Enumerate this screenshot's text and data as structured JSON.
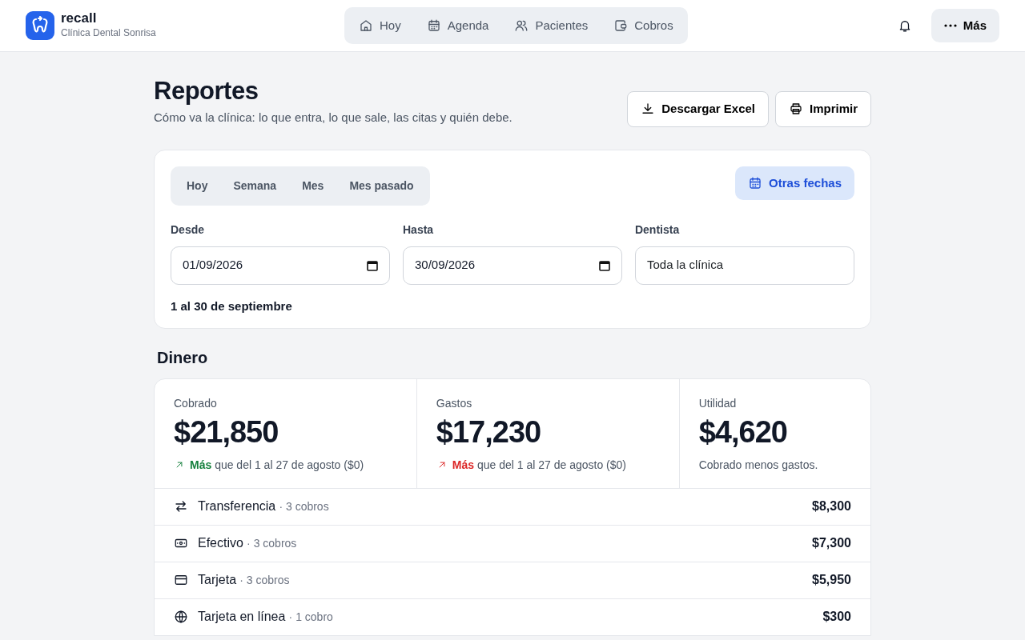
{
  "brand": {
    "name": "recall",
    "clinic": "Clínica Dental Sonrisa"
  },
  "nav": [
    {
      "label": "Hoy",
      "kind": "home"
    },
    {
      "label": "Agenda",
      "kind": "calendar"
    },
    {
      "label": "Pacientes",
      "kind": "people"
    },
    {
      "label": "Cobros",
      "kind": "wallet"
    }
  ],
  "more_button": "Más",
  "page": {
    "title": "Reportes",
    "subtitle": "Cómo va la clínica: lo que entra, lo que sale, las citas y quién debe.",
    "actions": [
      {
        "label": "Descargar Excel",
        "kind": "download"
      },
      {
        "label": "Imprimir",
        "kind": "print"
      }
    ]
  },
  "filters": {
    "periods": [
      "Hoy",
      "Semana",
      "Mes",
      "Mes pasado"
    ],
    "other_dates": "Otras fechas",
    "from": {
      "label": "Desde",
      "value": "01/09/2026"
    },
    "to": {
      "label": "Hasta",
      "value": "30/09/2026"
    },
    "dentist": {
      "label": "Dentista",
      "value": "Toda la clínica"
    },
    "range_text": "1 al 30 de septiembre"
  },
  "money": {
    "title": "Dinero",
    "stats": [
      {
        "label": "Cobrado",
        "value": "$21,850",
        "color": "#15803d",
        "emph": "Más",
        "note": "que del 1 al 27 de agosto ($0)"
      },
      {
        "label": "Gastos",
        "value": "$17,230",
        "color": "#dc2626",
        "emph": "Más",
        "note": "que del 1 al 27 de agosto ($0)"
      },
      {
        "label": "Utilidad",
        "value": "$4,620",
        "note": "Cobrado menos gastos."
      }
    ],
    "methods": [
      {
        "kind": "transfer",
        "name": "Transferencia",
        "count": "· 3 cobros",
        "amount": "$8,300"
      },
      {
        "kind": "cash",
        "name": "Efectivo",
        "count": "· 3 cobros",
        "amount": "$7,300"
      },
      {
        "kind": "card",
        "name": "Tarjeta",
        "count": "· 3 cobros",
        "amount": "$5,950"
      },
      {
        "kind": "online",
        "name": "Tarjeta en línea",
        "count": "· 1 cobro",
        "amount": "$300"
      }
    ]
  }
}
